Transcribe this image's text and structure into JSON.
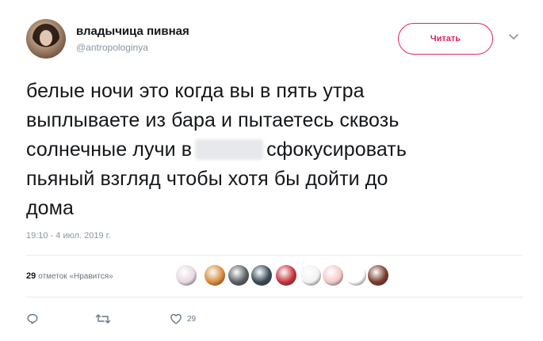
{
  "author": {
    "display_name": "владычица пивная",
    "handle": "@antropologinya"
  },
  "follow_button": {
    "label": "Читать"
  },
  "tweet": {
    "lines": [
      "белые ночи это когда вы в пять утра",
      "выплываете из бара и пытаетесь сквозь",
      "солнечные лучи в",
      "сфокусировать",
      "пьяный взгляд чтобы хотя бы дойти до",
      "дома"
    ],
    "timestamp": "19:10 - 4 июл. 2019 г."
  },
  "likes": {
    "count": "29",
    "label": "отметок «Нравится»",
    "likers": [
      {
        "name": "liker-1",
        "color": "#e8d7e2"
      },
      {
        "name": "liker-2",
        "color": "#d98a3a"
      },
      {
        "name": "liker-3",
        "color": "#5a5f66"
      },
      {
        "name": "liker-4",
        "color": "#3a4a55"
      },
      {
        "name": "liker-5",
        "color": "#c8323c"
      },
      {
        "name": "liker-6",
        "color": "#f2f2f2"
      },
      {
        "name": "liker-7",
        "color": "#f3c9c9"
      },
      {
        "name": "liker-8",
        "color": "#ffffff"
      },
      {
        "name": "liker-9",
        "color": "#7a3b2e"
      }
    ]
  },
  "actions": {
    "reply_icon": "reply-icon",
    "retweet_icon": "retweet-icon",
    "like_icon": "heart-icon",
    "like_count": "29"
  },
  "colors": {
    "accent": "#e0245e",
    "muted": "#8a96a3",
    "divider": "#e6ecf0"
  }
}
